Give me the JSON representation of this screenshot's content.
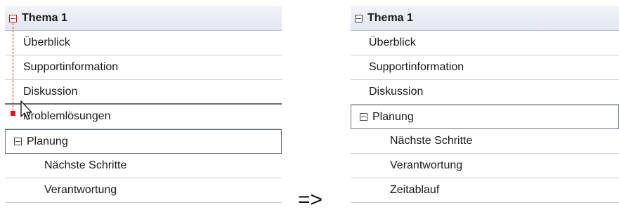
{
  "left": {
    "rows": [
      {
        "label": "Thema 1"
      },
      {
        "label": "Überblick"
      },
      {
        "label": "Supportinformation"
      },
      {
        "label": "Diskussion"
      },
      {
        "label": "Problemlösungen"
      },
      {
        "label": "Planung"
      },
      {
        "label": "Nächste Schritte"
      },
      {
        "label": "Verantwortung"
      }
    ]
  },
  "arrow": "=>",
  "right": {
    "rows": [
      {
        "label": "Thema 1"
      },
      {
        "label": "Überblick"
      },
      {
        "label": "Supportinformation"
      },
      {
        "label": "Diskussion"
      },
      {
        "label": "Planung"
      },
      {
        "label": "Nächste Schritte"
      },
      {
        "label": "Verantwortung"
      },
      {
        "label": "Zeitablauf"
      }
    ]
  },
  "colors": {
    "drag_indicator": "#d11a1a",
    "header_background": "#e6e9f1",
    "row_border": "#c9ced8"
  },
  "icons": {
    "collapse": "minus-box-icon",
    "cursor": "mouse-pointer-icon"
  }
}
